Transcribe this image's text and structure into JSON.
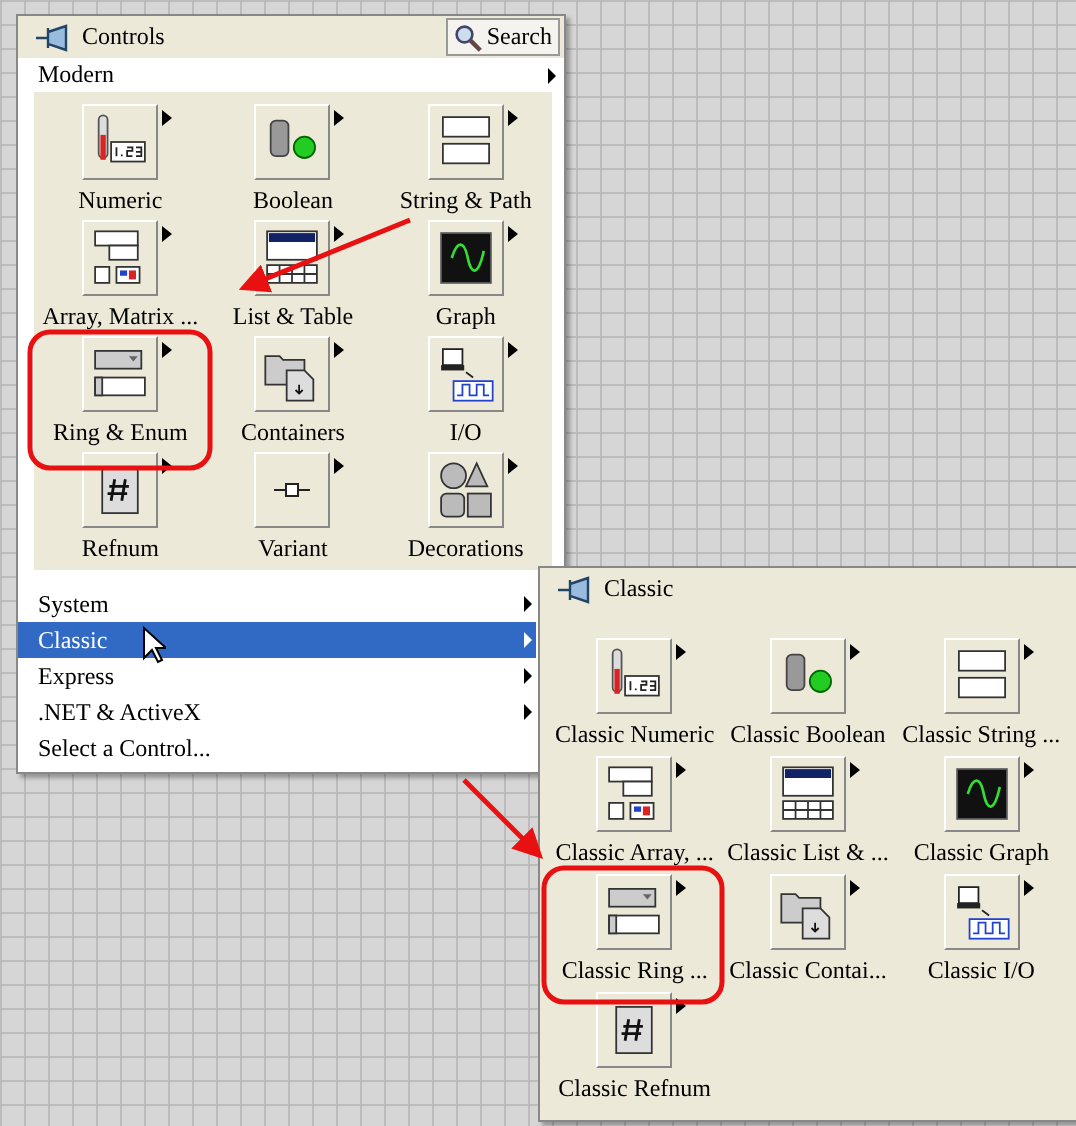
{
  "controls_palette": {
    "title": "Controls",
    "search_button": "Search",
    "category": "Modern",
    "items": [
      {
        "label": "Numeric"
      },
      {
        "label": "Boolean"
      },
      {
        "label": "String & Path"
      },
      {
        "label": "Array, Matrix ..."
      },
      {
        "label": "List & Table"
      },
      {
        "label": "Graph"
      },
      {
        "label": "Ring & Enum"
      },
      {
        "label": "Containers"
      },
      {
        "label": "I/O"
      },
      {
        "label": "Refnum"
      },
      {
        "label": "Variant"
      },
      {
        "label": "Decorations"
      }
    ],
    "menu": [
      {
        "label": "System",
        "selected": false,
        "submenu": true
      },
      {
        "label": "Classic",
        "selected": true,
        "submenu": true
      },
      {
        "label": "Express",
        "selected": false,
        "submenu": true
      },
      {
        "label": ".NET & ActiveX",
        "selected": false,
        "submenu": true
      },
      {
        "label": "Select a Control...",
        "selected": false,
        "submenu": false
      }
    ]
  },
  "classic_palette": {
    "title": "Classic",
    "items": [
      {
        "label": "Classic Numeric"
      },
      {
        "label": "Classic Boolean"
      },
      {
        "label": "Classic String ..."
      },
      {
        "label": "Classic Array, ..."
      },
      {
        "label": "Classic List & ..."
      },
      {
        "label": "Classic Graph"
      },
      {
        "label": "Classic Ring ..."
      },
      {
        "label": "Classic Contai..."
      },
      {
        "label": "Classic I/O"
      },
      {
        "label": "Classic Refnum"
      }
    ]
  }
}
